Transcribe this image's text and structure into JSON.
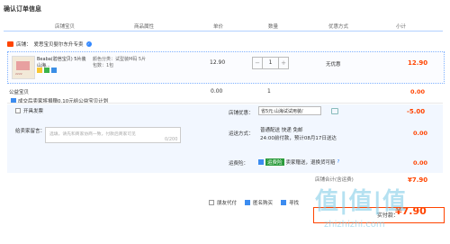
{
  "page": {
    "title": "确认订单信息"
  },
  "columns": [
    "店铺宝贝",
    "商品属性",
    "单价",
    "数量",
    "优惠方式",
    "小计"
  ],
  "shop": {
    "label": "店铺：",
    "name": "爱思宝贝婴尔东升专卖"
  },
  "item": {
    "name": "Beaba(碧芭宝贝) 5片装 山海...",
    "spec_lines": [
      "颜色分类：试型装M码 5片",
      "包数：1包"
    ],
    "price": "12.90",
    "qty": "1",
    "promo": "无优惠",
    "subtotal": "12.90",
    "thumb_text": "2222"
  },
  "public": {
    "title": "公益宝贝",
    "desc": "成交后卖家将捐赠0.10元给公益宝贝计划",
    "price": "0.00",
    "qty": "1",
    "subtotal": "0.00"
  },
  "invoice": {
    "label": "开具发票"
  },
  "message": {
    "label": "给卖家留言：",
    "placeholder": "选填，请先和商家协商一致，付款后商家可见",
    "count": "0/200"
  },
  "discount": {
    "label": "店铺优惠：",
    "selected": "省5元:山海试试用装/",
    "amount": "-5.00"
  },
  "shipping": {
    "label": "运送方式：",
    "line1": "普通配送 快递 免邮",
    "line2": "24:00前付款，预计08月17日送达",
    "cost": "0.00"
  },
  "insurance": {
    "label": "运费险：",
    "tag": "运费险",
    "desc": "卖家赠送，退换货可赔",
    "cost": "0.00"
  },
  "aggregate": {
    "label": "店铺合计(含运费)",
    "total": "¥7.90"
  },
  "options": {
    "anon": "匿名购买",
    "friend": "朋友代付",
    "third": "寻找"
  },
  "pay": {
    "label": "实付款：",
    "amount": "¥7.90"
  },
  "watermark": {
    "big": "值|值|值",
    "small": "zhizhizhi.com"
  }
}
